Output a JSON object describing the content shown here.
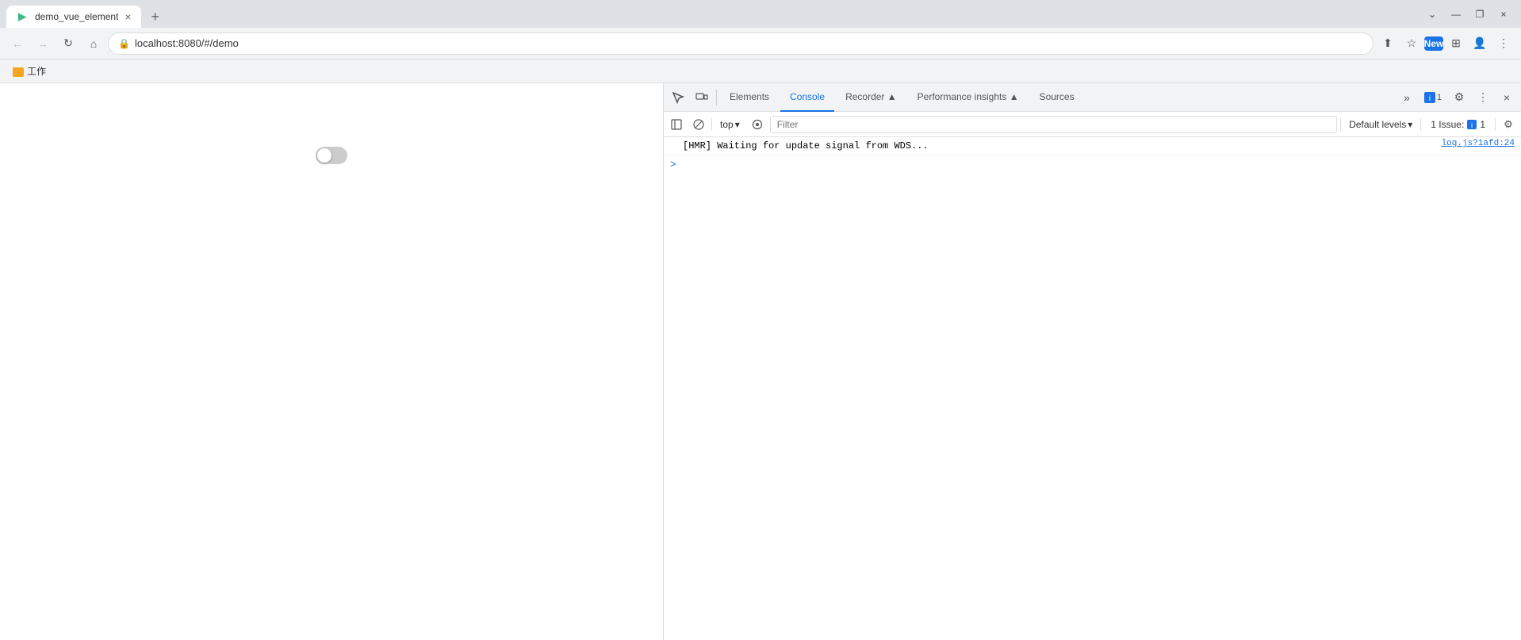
{
  "browser": {
    "tab": {
      "favicon_color": "#42b883",
      "favicon_text": "▶",
      "title": "demo_vue_element",
      "close_label": "×"
    },
    "new_tab_label": "+",
    "window_controls": {
      "minimize": "—",
      "maximize": "❐",
      "close": "×",
      "chevron": "⌄"
    },
    "address_bar": {
      "back_label": "←",
      "forward_label": "→",
      "refresh_label": "↻",
      "home_label": "⌂",
      "url": "localhost:8080/#/demo",
      "lock_icon": "",
      "share_label": "⬆",
      "star_label": "☆",
      "extensions_label": "⊞",
      "profile_label": "👤"
    },
    "bookmarks_bar": {
      "item_label": "工作"
    }
  },
  "page": {
    "toggle_state": "off"
  },
  "devtools": {
    "header": {
      "inspect_label": "⬚",
      "device_label": "⬜",
      "tabs": [
        {
          "id": "elements",
          "label": "Elements",
          "active": false
        },
        {
          "id": "console",
          "label": "Console",
          "active": true
        },
        {
          "id": "recorder",
          "label": "Recorder ▲",
          "active": false
        },
        {
          "id": "performance",
          "label": "Performance insights ▲",
          "active": false
        },
        {
          "id": "sources",
          "label": "Sources",
          "active": false
        }
      ],
      "more_tabs_label": "»",
      "issues_badge_icon": "🔵",
      "issues_count": "1",
      "settings_label": "⚙",
      "more_label": "⋮",
      "close_label": "×"
    },
    "toolbar": {
      "sidebar_label": "⬚",
      "clear_label": "🚫",
      "context": "top",
      "context_arrow": "▾",
      "eye_label": "👁",
      "filter_placeholder": "Filter",
      "levels_label": "Default levels",
      "levels_arrow": "▾",
      "issues_label": "1 Issue:",
      "issues_icon": "🔵",
      "issues_count": "1",
      "gear_label": "⚙"
    },
    "console": {
      "entries": [
        {
          "type": "log",
          "text": "[HMR] Waiting for update signal from WDS...",
          "source": "log.js?1afd:24",
          "has_expand": false
        }
      ],
      "prompt_chevron": ">"
    }
  }
}
